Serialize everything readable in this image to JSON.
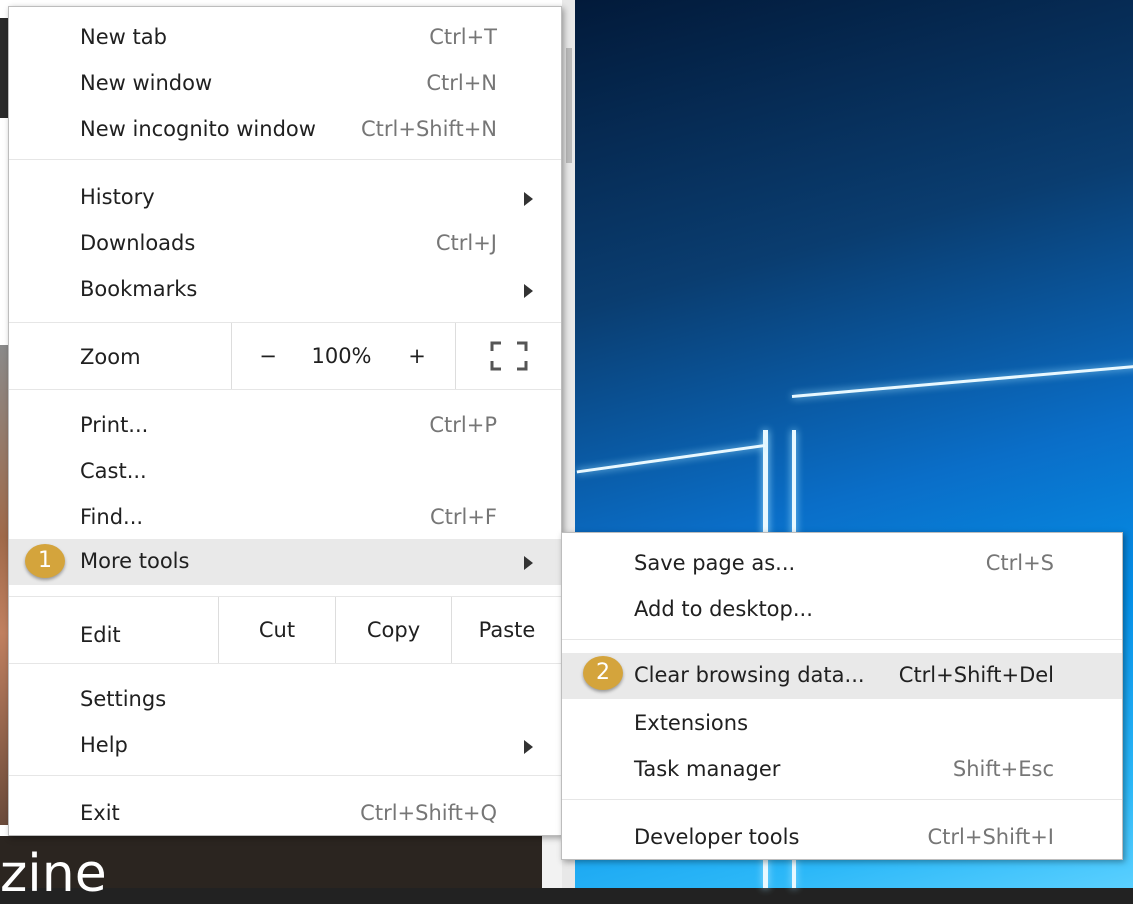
{
  "background": {
    "headline_fragment": "zine"
  },
  "main_menu": {
    "new_tab": {
      "label": "New tab",
      "shortcut": "Ctrl+T"
    },
    "new_window": {
      "label": "New window",
      "shortcut": "Ctrl+N"
    },
    "new_incognito": {
      "label": "New incognito window",
      "shortcut": "Ctrl+Shift+N"
    },
    "history": {
      "label": "History"
    },
    "downloads": {
      "label": "Downloads",
      "shortcut": "Ctrl+J"
    },
    "bookmarks": {
      "label": "Bookmarks"
    },
    "zoom": {
      "label": "Zoom",
      "minus": "−",
      "value": "100%",
      "plus": "+"
    },
    "print": {
      "label": "Print...",
      "shortcut": "Ctrl+P"
    },
    "cast": {
      "label": "Cast..."
    },
    "find": {
      "label": "Find...",
      "shortcut": "Ctrl+F"
    },
    "more_tools": {
      "label": "More tools",
      "badge": "1"
    },
    "edit": {
      "label": "Edit",
      "cut": "Cut",
      "copy": "Copy",
      "paste": "Paste"
    },
    "settings": {
      "label": "Settings"
    },
    "help": {
      "label": "Help"
    },
    "exit": {
      "label": "Exit",
      "shortcut": "Ctrl+Shift+Q"
    }
  },
  "sub_menu": {
    "save_page": {
      "label": "Save page as...",
      "shortcut": "Ctrl+S"
    },
    "add_desktop": {
      "label": "Add to desktop..."
    },
    "clear_data": {
      "label": "Clear browsing data...",
      "shortcut": "Ctrl+Shift+Del",
      "badge": "2"
    },
    "extensions": {
      "label": "Extensions"
    },
    "task_manager": {
      "label": "Task manager",
      "shortcut": "Shift+Esc"
    },
    "dev_tools": {
      "label": "Developer tools",
      "shortcut": "Ctrl+Shift+I"
    }
  },
  "colors": {
    "badge": "#d4a43c",
    "highlight": "#e9e9e9"
  }
}
